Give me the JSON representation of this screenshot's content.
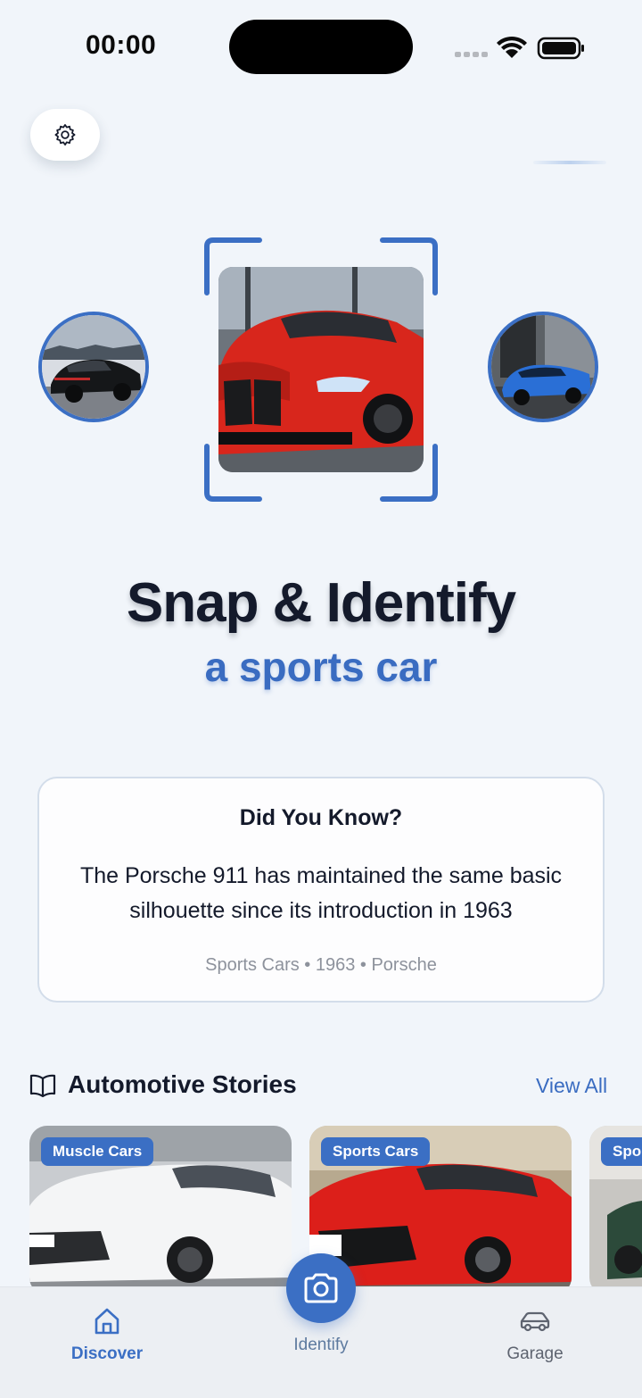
{
  "status_bar": {
    "time": "00:00"
  },
  "header": {
    "settings_icon": "gear-icon"
  },
  "hero": {
    "title": "Snap & Identify",
    "subtitle": "a sports car",
    "accent_color": "#3a6cc1"
  },
  "fact_card": {
    "heading": "Did You Know?",
    "text": "The Porsche 911 has maintained the same basic silhouette since its introduction in 1963",
    "meta": "Sports Cars • 1963 • Porsche"
  },
  "stories": {
    "icon": "book-open-icon",
    "heading": "Automotive Stories",
    "view_all": "View All",
    "cards": [
      {
        "badge": "Muscle Cars"
      },
      {
        "badge": "Sports Cars"
      },
      {
        "badge": "Spo"
      }
    ]
  },
  "bottom_nav": {
    "discover": "Discover",
    "identify": "Identify",
    "garage": "Garage",
    "active_color": "#3b6fc4"
  }
}
